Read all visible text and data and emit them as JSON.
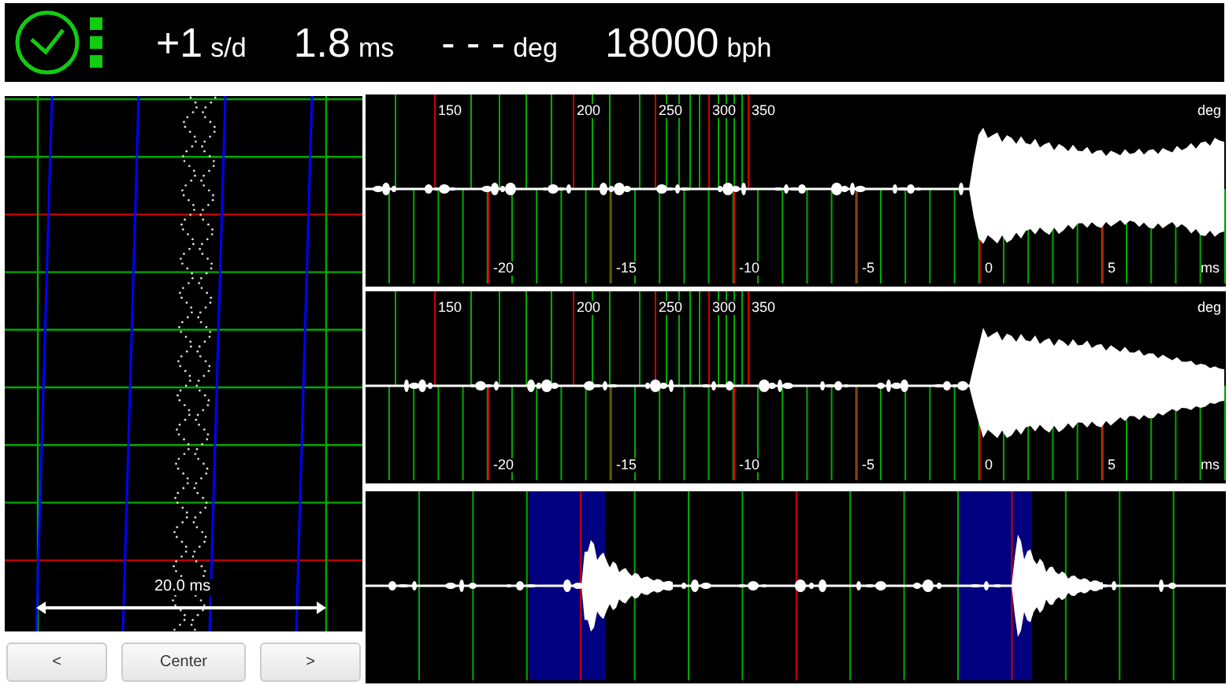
{
  "readouts": [
    {
      "value": "+1",
      "unit": "s/d"
    },
    {
      "value": "1.8",
      "unit": "ms"
    },
    {
      "value": "- - -",
      "unit": "deg"
    },
    {
      "value": "18000",
      "unit": "bph"
    }
  ],
  "status_indicator": {
    "on": true
  },
  "timegrapher": {
    "scale_label": "20.0 ms"
  },
  "buttons": [
    "<",
    "Center",
    ">"
  ],
  "trace_panels": [
    {
      "deg_ticks": [
        "150",
        "200",
        "250",
        "300",
        "350"
      ],
      "deg_unit": "deg",
      "ms_ticks": [
        "-20",
        "-15",
        "-10",
        "-5",
        "0",
        "5"
      ],
      "ms_unit": "ms"
    },
    {
      "deg_ticks": [
        "150",
        "200",
        "250",
        "300",
        "350"
      ],
      "deg_unit": "deg",
      "ms_ticks": [
        "-20",
        "-15",
        "-10",
        "-5",
        "0",
        "5"
      ],
      "ms_unit": "ms"
    }
  ]
}
